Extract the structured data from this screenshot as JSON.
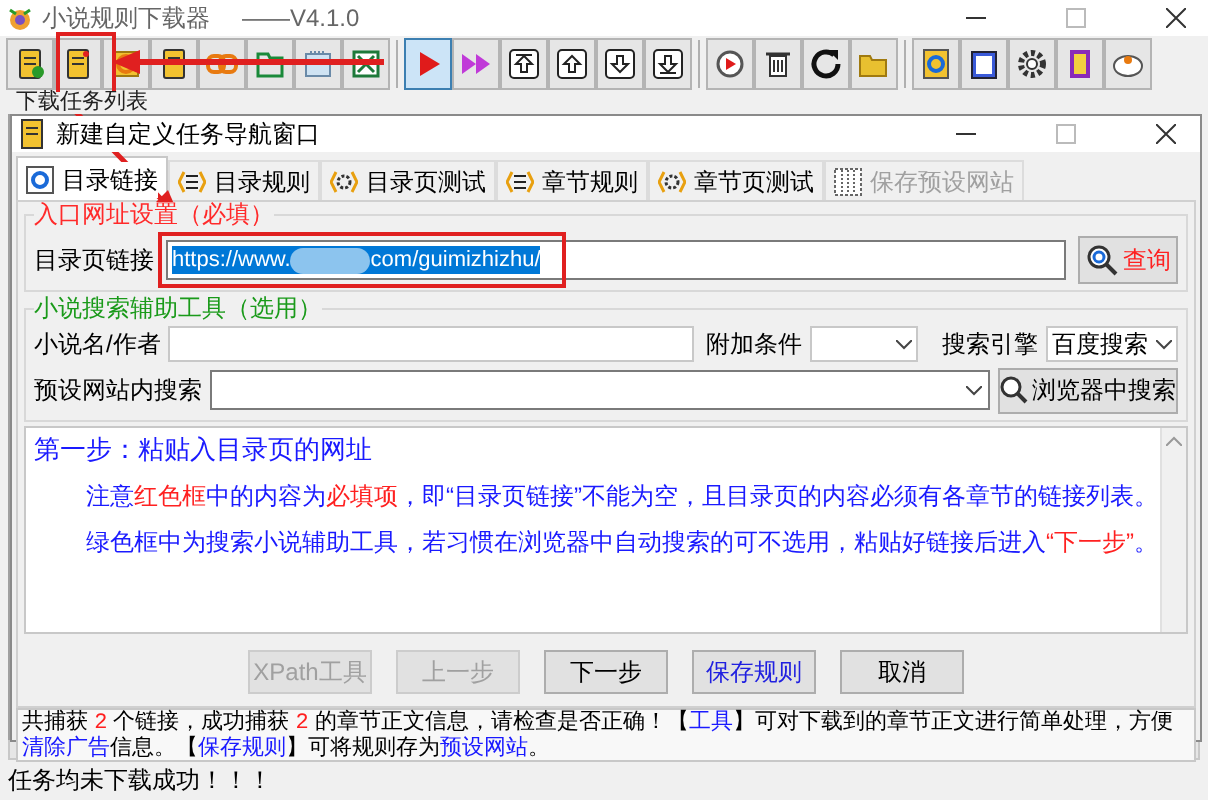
{
  "window": {
    "title": "小说规则下载器",
    "version": "——V4.1.0"
  },
  "toolbar": [
    {
      "selected": false
    },
    {
      "selected": false
    },
    {
      "selected": false
    },
    {
      "selected": false
    },
    {
      "selected": false
    },
    {
      "selected": false
    },
    {
      "selected": false
    },
    {
      "selected": false
    },
    {
      "selected": true
    },
    {
      "selected": false
    },
    {
      "selected": false
    },
    {
      "selected": false
    },
    {
      "selected": false
    },
    {
      "selected": false
    },
    {
      "selected": false
    },
    {
      "selected": false
    },
    {
      "selected": false
    },
    {
      "selected": false
    },
    {
      "selected": false
    },
    {
      "selected": false
    },
    {
      "selected": false
    },
    {
      "selected": false
    },
    {
      "selected": false
    }
  ],
  "task_list": {
    "label": "下载任务列表"
  },
  "dialog": {
    "title": "新建自定义任务导航窗口",
    "tabs": [
      {
        "label": "目录链接",
        "selected": true,
        "disabled": false
      },
      {
        "label": "目录规则",
        "selected": false,
        "disabled": false
      },
      {
        "label": "目录页测试",
        "selected": false,
        "disabled": false
      },
      {
        "label": "章节规则",
        "selected": false,
        "disabled": false
      },
      {
        "label": "章节页测试",
        "selected": false,
        "disabled": false
      },
      {
        "label": "保存预设网站",
        "selected": false,
        "disabled": true
      }
    ],
    "entry_group": {
      "label": "入口网址设置（必填）",
      "field_label": "目录页链接",
      "url_start": "https://www.",
      "url_end": "com/guimizhizhu/",
      "query_button": "查询"
    },
    "search_group": {
      "label": "小说搜索辅助工具（选用）",
      "name_label": "小说名/作者",
      "condition_label": "附加条件",
      "engine_label": "搜索引擎",
      "engine_value": "百度搜索",
      "site_label": "预设网站内搜索",
      "browser_button": "浏览器中搜索"
    },
    "instructions": [
      {
        "kind": "heading",
        "segments": [
          {
            "kind": "text",
            "text": "第一步：粘贴入目录页的网址"
          }
        ]
      },
      {
        "kind": "note",
        "segments": [
          {
            "kind": "text",
            "text": "注意"
          },
          {
            "kind": "red",
            "text": "红色框"
          },
          {
            "kind": "text",
            "text": "中的内容为"
          },
          {
            "kind": "red",
            "text": "必填项"
          },
          {
            "kind": "text",
            "text": "，即“目录页链接”不能为空，且目录页的内容必须有各章节的链接列表。"
          }
        ]
      },
      {
        "kind": "note",
        "segments": [
          {
            "kind": "text",
            "text": "绿色框中为搜索小说辅助工具，若习惯在浏览器中自动搜索的可不选用，粘贴好链接后进入"
          },
          {
            "kind": "red",
            "text": "“下一步”"
          },
          {
            "kind": "text",
            "text": "。"
          }
        ]
      }
    ],
    "buttons": [
      {
        "label": "XPath工具",
        "disabled": true,
        "kind": "normal"
      },
      {
        "label": "上一步",
        "disabled": true,
        "kind": "normal"
      },
      {
        "label": "下一步",
        "disabled": false,
        "kind": "normal"
      },
      {
        "label": "保存规则",
        "disabled": false,
        "kind": "accent"
      },
      {
        "label": "取消",
        "disabled": false,
        "kind": "normal"
      }
    ],
    "info": [
      {
        "kind": "text",
        "text": "共捕获 "
      },
      {
        "kind": "count",
        "text": "2"
      },
      {
        "kind": "text",
        "text": " 个链接，成功捕获 "
      },
      {
        "kind": "count",
        "text": "2"
      },
      {
        "kind": "text",
        "text": " 的章节正文信息，请检查是否正确！【"
      },
      {
        "kind": "link",
        "text": "工具"
      },
      {
        "kind": "text",
        "text": "】可对下载到的章节正文进行简单处理，方便"
      },
      {
        "kind": "link",
        "text": "清除广告"
      },
      {
        "kind": "text",
        "text": "信息。【"
      },
      {
        "kind": "link",
        "text": "保存规则"
      },
      {
        "kind": "text",
        "text": "】可将规则存为"
      },
      {
        "kind": "link",
        "text": "预设网站"
      },
      {
        "kind": "text",
        "text": "。"
      }
    ]
  },
  "status_bar": "任务均未下载成功！！！"
}
